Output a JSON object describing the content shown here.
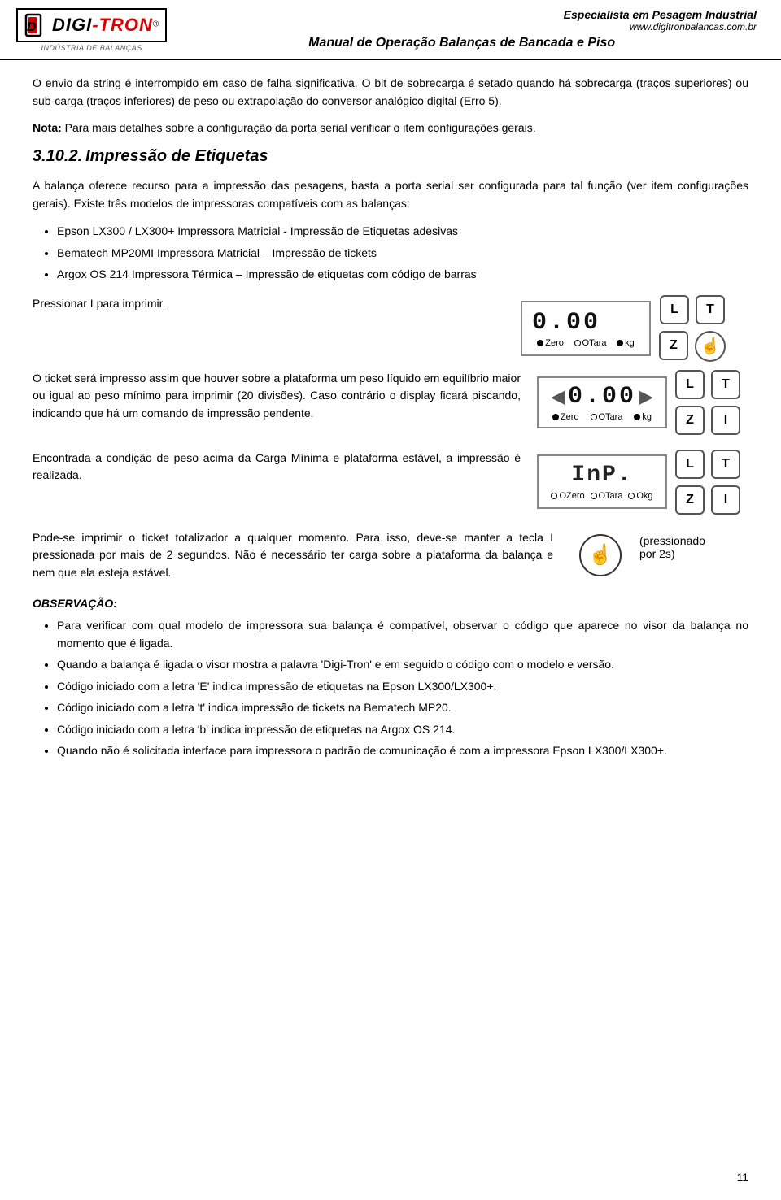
{
  "header": {
    "logo_digi": "DIGI",
    "logo_hyphen": "-",
    "logo_tron": "TRON",
    "logo_reg": "®",
    "logo_subtitle": "INDÚSTRIA DE BALANÇAS",
    "specialist": "Especialista em Pesagem Industrial",
    "website": "www.digitronbalancas.com.br",
    "manual_title": "Manual de Operação Balanças de Bancada e Piso"
  },
  "content": {
    "para1": "O envio da string é interrompido em caso de falha significativa. O bit de sobrecarga é setado quando há sobrecarga (traços superiores) ou sub-carga (traços inferiores) de peso ou extrapolação do conversor analógico digital (Erro 5).",
    "nota_label": "Nota:",
    "nota_text": " Para mais detalhes sobre a configuração da porta serial verificar o item configurações gerais.",
    "section_num": "3.10.2.",
    "section_title": "Impressão de Etiquetas",
    "para2": "A balança oferece recurso para a impressão das pesagens, basta a porta serial ser configurada para tal função (ver item configurações gerais). Existe três modelos de impressoras compatíveis com as balanças:",
    "bullets_printers": [
      "Epson LX300 / LX300+ Impressora Matricial - Impressão de Etiquetas adesivas",
      "Bematech MP20MI Impressora Matricial – Impressão de tickets",
      "Argox OS 214 Impressora Térmica – Impressão de etiquetas com código de barras"
    ],
    "pressionar_text": "Pressionar I para imprimir.",
    "display1_digits": "0.00",
    "display1_labels": [
      "Zero",
      "OTara",
      "kg"
    ],
    "display1_dots": [
      "filled",
      "empty",
      "filled"
    ],
    "ticket_text": "O ticket será impresso assim que houver sobre a plataforma um peso líquido em equilíbrio maior ou igual ao peso mínimo para imprimir (20 divisões). Caso contrário o display ficará piscando, indicando que há um comando de impressão pendente.",
    "display2_digits": "0.00",
    "display2_labels": [
      "Zero",
      "OTara",
      "kg"
    ],
    "display2_dots": [
      "filled",
      "empty",
      "filled"
    ],
    "found_text": "Encontrada a condição de peso acima da Carga Mínima e plataforma estável, a impressão é realizada.",
    "display3_digits": "InP.",
    "display3_labels": [
      "OZero",
      "OTara",
      "Okg"
    ],
    "display3_dots": [
      "empty",
      "empty",
      "empty"
    ],
    "pode_text1": "Pode-se imprimir o ticket totalizador a qualquer momento. Para isso, deve-se manter a tecla I pressionada por mais de 2 segundos. Não é necessário ter carga sobre a plataforma da balança e nem que ela esteja estável.",
    "pressionado_label": "(pressionado",
    "por2s_label": "por 2s)",
    "obs_title": "OBSERVAÇÃO:",
    "obs_bullets": [
      "Para verificar com qual modelo de impressora sua balança é compatível, observar o código que aparece no visor da balança no momento que é ligada.",
      "Quando a balança é ligada o visor mostra a palavra 'Digi-Tron' e em seguido o código com o modelo e versão.",
      "Código iniciado com a letra 'E' indica impressão de etiquetas na Epson LX300/LX300+.",
      "Código iniciado com a letra 't' indica impressão de tickets na Bematech MP20.",
      "Código iniciado com a letra 'b' indica impressão de etiquetas na Argox OS 214.",
      "Quando não é solicitada interface para impressora o padrão de comunicação é com a impressora Epson LX300/LX300+."
    ],
    "page_number": "11"
  }
}
